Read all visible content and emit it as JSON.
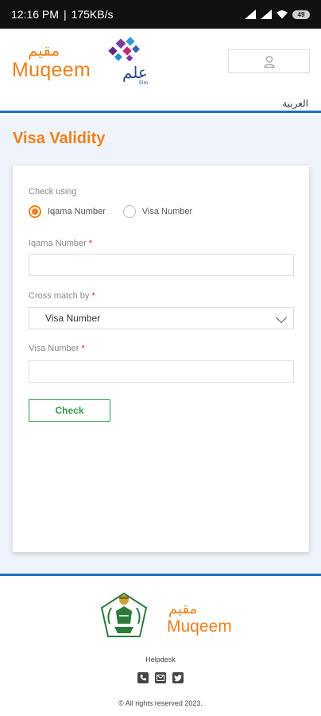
{
  "status_bar": {
    "time": "12:16 PM",
    "speed": "175KB/s",
    "battery": "49"
  },
  "header": {
    "logo_ar": "مقيم",
    "logo_en": "Muqeem",
    "elm_ar": "علم",
    "elm_en": "Elm",
    "language_link": "العربية"
  },
  "main": {
    "page_title": "Visa Validity",
    "form": {
      "check_using_label": "Check using",
      "radio_options": [
        {
          "label": "Iqama Number",
          "checked": true
        },
        {
          "label": "Visa Number",
          "checked": false
        }
      ],
      "iqama_label": "Iqama Number",
      "iqama_value": "",
      "cross_match_label": "Cross match by",
      "cross_match_value": "Visa Number",
      "visa_label": "Visa Number",
      "visa_value": "",
      "required_mark": "*",
      "check_button": "Check"
    }
  },
  "footer": {
    "logo_ar": "مقيم",
    "logo_en": "Muqeem",
    "helpdesk": "Helpdesk",
    "icons": [
      "phone-icon",
      "mail-icon",
      "twitter-icon"
    ],
    "copyright": "© All rights reserved 2023."
  },
  "colors": {
    "accent": "#ef7f1a",
    "border_blue": "#1f6fbf",
    "button_green": "#2e9b46",
    "required": "#e02020"
  }
}
